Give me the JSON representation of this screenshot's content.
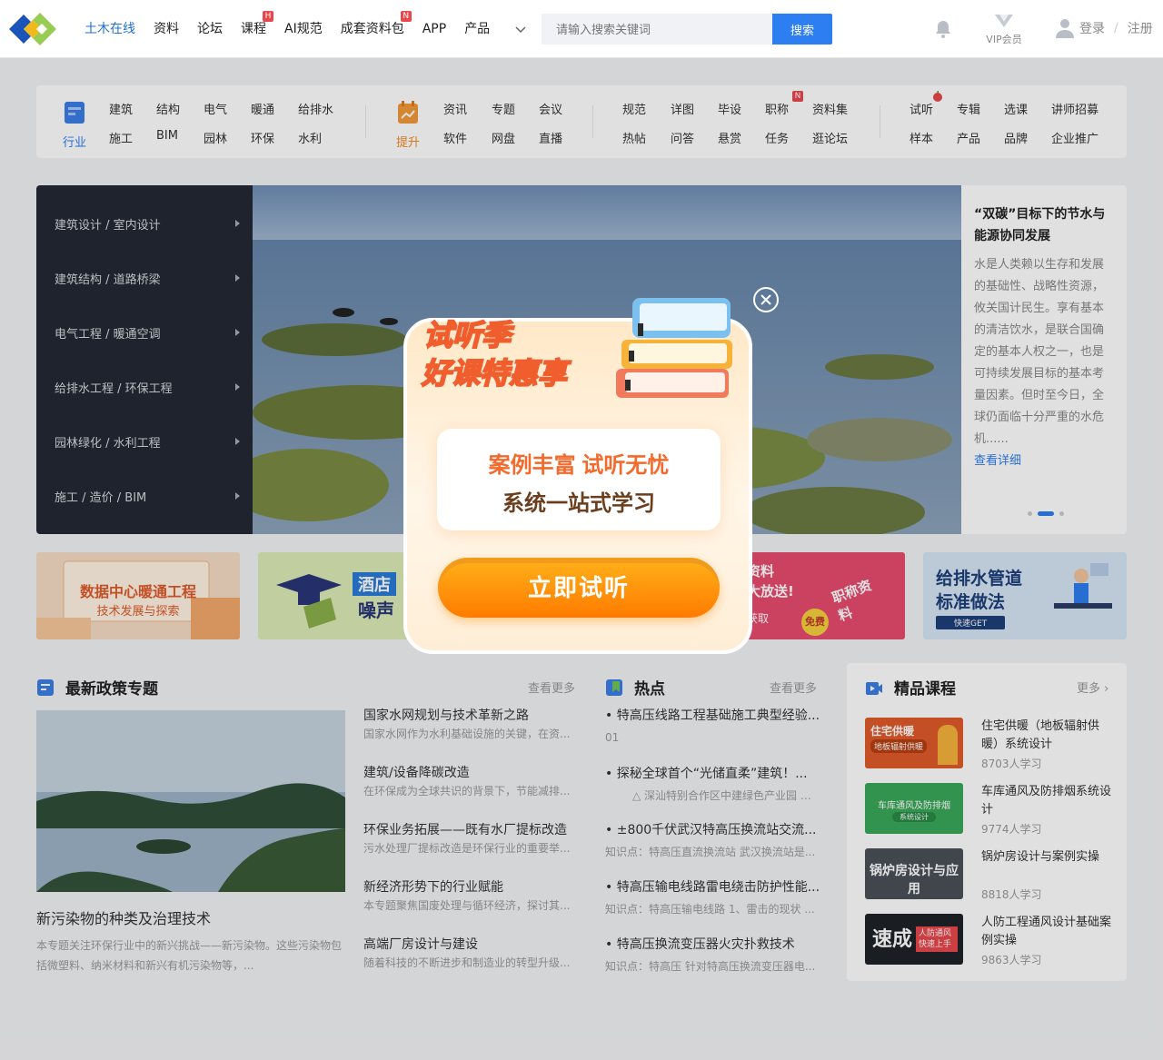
{
  "nav": {
    "items": [
      {
        "label": "土木在线",
        "active": true
      },
      {
        "label": "资料"
      },
      {
        "label": "论坛"
      },
      {
        "label": "课程",
        "badge": "H"
      },
      {
        "label": "AI规范"
      },
      {
        "label": "成套资料包",
        "badge": "N"
      },
      {
        "label": "APP"
      },
      {
        "label": "产品"
      }
    ]
  },
  "search": {
    "placeholder": "请输入搜索关键词",
    "button": "搜索"
  },
  "vip_label": "VIP会员",
  "user": {
    "login": "登录",
    "separator": "/",
    "register": "注册"
  },
  "categories": {
    "group1": {
      "label": "行业",
      "links": [
        "建筑",
        "结构",
        "电气",
        "暖通",
        "给排水",
        "施工",
        "BIM",
        "园林",
        "环保",
        "水利"
      ]
    },
    "group2": {
      "label": "提升",
      "links": [
        "资讯",
        "专题",
        "会议",
        "软件",
        "网盘",
        "直播"
      ]
    },
    "group3": {
      "links": [
        "规范",
        "详图",
        "毕设",
        "职称",
        "资料集",
        "热帖",
        "问答",
        "悬赏",
        "任务",
        "逛论坛"
      ],
      "badge": "N"
    },
    "group4": {
      "links": [
        "试听",
        "专辑",
        "选课",
        "讲师招募",
        "样本",
        "产品",
        "品牌",
        "企业推广"
      ]
    }
  },
  "side_menu": [
    "建筑设计 / 室内设计",
    "建筑结构 / 道路桥梁",
    "电气工程 / 暖通空调",
    "给排水工程 / 环保工程",
    "园林绿化 / 水利工程",
    "施工 / 造价 / BIM"
  ],
  "news_card": {
    "title": "“双碳”目标下的节水与能源协同发展",
    "body": "水是人类赖以生存和发展的基础性、战略性资源，攸关国计民生。享有基本的清洁饮水，是联合国确定的基本人权之一，也是可持续发展目标的基本考量因素。但时至今日，全球仍面临十分严重的水危机......",
    "more": "查看详细"
  },
  "promos": [
    {
      "l1": "数据中心暖通工程",
      "l2": "技术发展与探索"
    },
    {
      "l1": "酒店",
      "l2": "噪声"
    },
    {
      "l1": "资料",
      "l2": "大放送!",
      "l3": "职称资料",
      "l4": "免费",
      "l5": "获取"
    },
    {
      "l1": "给排水管道",
      "l2": "标准做法",
      "l3": "快速GET"
    }
  ],
  "policy": {
    "title": "最新政策专题",
    "more": "查看更多",
    "feature": {
      "title": "新污染物的种类及治理技术",
      "desc": "本专题关注环保行业中的新兴挑战——新污染物。这些污染物包括微塑料、纳米材料和新兴有机污染物等，..."
    },
    "items": [
      {
        "title": "国家水网规划与技术革新之路",
        "desc": "国家水网作为水利基础设施的关键，在资..."
      },
      {
        "title": "建筑/设备降碳改造",
        "desc": "在环保成为全球共识的背景下，节能减排..."
      },
      {
        "title": "环保业务拓展——既有水厂提标改造",
        "desc": "污水处理厂提标改造是环保行业的重要举..."
      },
      {
        "title": "新经济形势下的行业赋能",
        "desc": "本专题聚焦国废处理与循环经济，探讨其..."
      },
      {
        "title": "高端厂房设计与建设",
        "desc": "随着科技的不断进步和制造业的转型升级..."
      }
    ]
  },
  "hot": {
    "title": "热点",
    "more": "查看更多",
    "items": [
      {
        "title": "• 特高压线路工程基础施工典型经验...",
        "desc": "01"
      },
      {
        "title": "• 探秘全球首个“光储直柔”建筑！...",
        "desc": "△ 深汕特别合作区中建绿色产业园 国..."
      },
      {
        "title": "• ±800千伏武汉特高压换流站交流...",
        "desc": "知识点：特高压直流换流站 武汉换流站是..."
      },
      {
        "title": "• 特高压输电线路雷电绕击防护性能...",
        "desc": "知识点：特高压输电线路 1、雷击的现状 ..."
      },
      {
        "title": "• 特高压换流变压器火灾扑救技术",
        "desc": "知识点：特高压 针对特高压换流变压器电..."
      }
    ]
  },
  "courses": {
    "title": "精品课程",
    "more": "更多 ›",
    "items": [
      {
        "title": "住宅供暖（地板辐射供暖）系统设计",
        "stat": "8703人学习",
        "thumb_text": "住宅供暖",
        "thumb_sub": "地板辐射供暖"
      },
      {
        "title": "车库通风及防排烟系统设计",
        "stat": "9774人学习",
        "thumb_text": "车库通风及防排烟",
        "thumb_sub": "系统设计"
      },
      {
        "title": "锅炉房设计与案例实操",
        "stat": "8818人学习",
        "thumb_text": "锅炉房设计与应用",
        "thumb_sub": ""
      },
      {
        "title": "人防工程通风设计基础案例实操",
        "stat": "9863人学习",
        "thumb_text": "速成",
        "thumb_sub": "人防通风 快速上手"
      }
    ]
  },
  "modal": {
    "headline1": "试听季",
    "headline2": "好课特惠享",
    "line1": "案例丰富 试听无忧",
    "line2": "系统一站式学习",
    "button": "立即试听"
  },
  "colors": {
    "primary": "#2d7ef0",
    "nav_active": "#1f6fd1",
    "badge": "#e8474c",
    "sidemenu_bg": "#232834",
    "modal_orange": "#ff8a00"
  }
}
